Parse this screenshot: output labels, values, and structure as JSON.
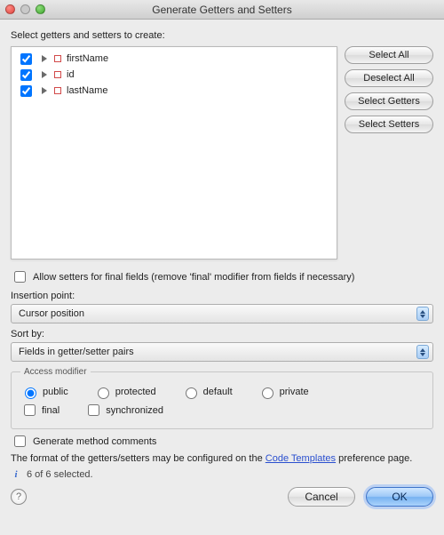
{
  "window": {
    "title": "Generate Getters and Setters"
  },
  "prompt": "Select getters and setters to create:",
  "tree": {
    "items": [
      {
        "name": "firstName",
        "checked": true
      },
      {
        "name": "id",
        "checked": true
      },
      {
        "name": "lastName",
        "checked": true
      }
    ]
  },
  "sideButtons": {
    "selectAll": "Select All",
    "deselectAll": "Deselect All",
    "selectGetters": "Select Getters",
    "selectSetters": "Select Setters"
  },
  "allowFinal": {
    "checked": false,
    "label": "Allow setters for final fields (remove 'final' modifier from fields if necessary)"
  },
  "insertion": {
    "label": "Insertion point:",
    "value": "Cursor position"
  },
  "sort": {
    "label": "Sort by:",
    "value": "Fields in getter/setter pairs"
  },
  "access": {
    "legend": "Access modifier",
    "options": {
      "public": "public",
      "protected": "protected",
      "default": "default",
      "private": "private"
    },
    "selected": "public",
    "final": {
      "label": "final",
      "checked": false
    },
    "synchronized": {
      "label": "synchronized",
      "checked": false
    }
  },
  "generateComments": {
    "label": "Generate method comments",
    "checked": false
  },
  "formatNote": {
    "prefix": "The format of the getters/setters may be configured on the ",
    "link": "Code Templates",
    "suffix": " preference page."
  },
  "status": "6 of 6 selected.",
  "buttons": {
    "cancel": "Cancel",
    "ok": "OK"
  }
}
